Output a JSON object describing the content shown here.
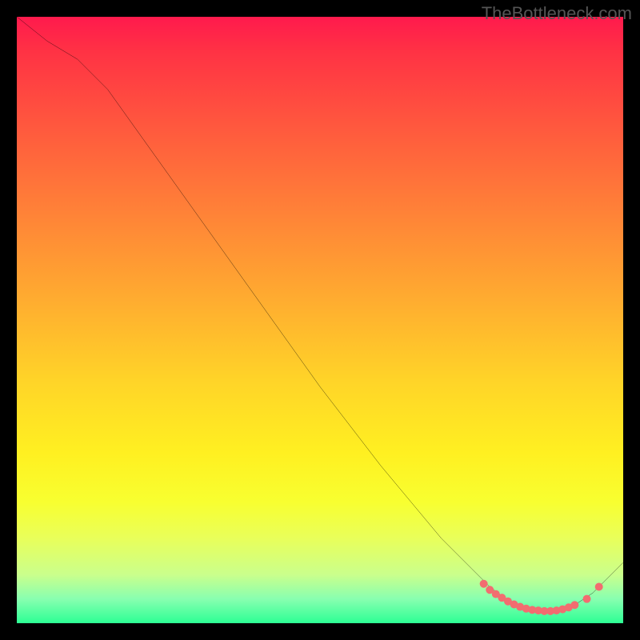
{
  "watermark": "TheBottleneck.com",
  "chart_data": {
    "type": "line",
    "title": "",
    "xlabel": "",
    "ylabel": "",
    "xlim": [
      0,
      100
    ],
    "ylim": [
      0,
      100
    ],
    "series": [
      {
        "name": "bottleneck-curve",
        "x": [
          0,
          5,
          10,
          15,
          20,
          25,
          30,
          35,
          40,
          45,
          50,
          55,
          60,
          65,
          70,
          75,
          78,
          80,
          82,
          85,
          88,
          90,
          92,
          95,
          100
        ],
        "y": [
          100,
          96,
          93,
          88,
          81,
          74,
          67,
          60,
          53,
          46,
          39,
          32.5,
          26,
          20,
          14,
          9,
          6,
          4.5,
          3,
          2,
          2,
          2,
          3,
          5,
          10
        ],
        "stroke": "#000000",
        "stroke_width": 2
      }
    ],
    "markers": {
      "name": "valley-dots",
      "x": [
        77,
        78,
        79,
        80,
        81,
        82,
        83,
        84,
        85,
        86,
        87,
        88,
        89,
        90,
        91,
        92,
        94,
        96
      ],
      "y": [
        6.5,
        5.5,
        4.8,
        4.2,
        3.6,
        3.1,
        2.7,
        2.4,
        2.2,
        2.1,
        2.0,
        2.0,
        2.1,
        2.3,
        2.6,
        3.0,
        4.0,
        6.0
      ],
      "color": "#f26d70",
      "radius": 5
    },
    "gradient_stops": [
      {
        "pos": 0.0,
        "color": "#ff1a4d"
      },
      {
        "pos": 0.2,
        "color": "#ff5e3d"
      },
      {
        "pos": 0.48,
        "color": "#ffb02f"
      },
      {
        "pos": 0.72,
        "color": "#fff021"
      },
      {
        "pos": 0.92,
        "color": "#caff8c"
      },
      {
        "pos": 1.0,
        "color": "#2cff94"
      }
    ]
  }
}
